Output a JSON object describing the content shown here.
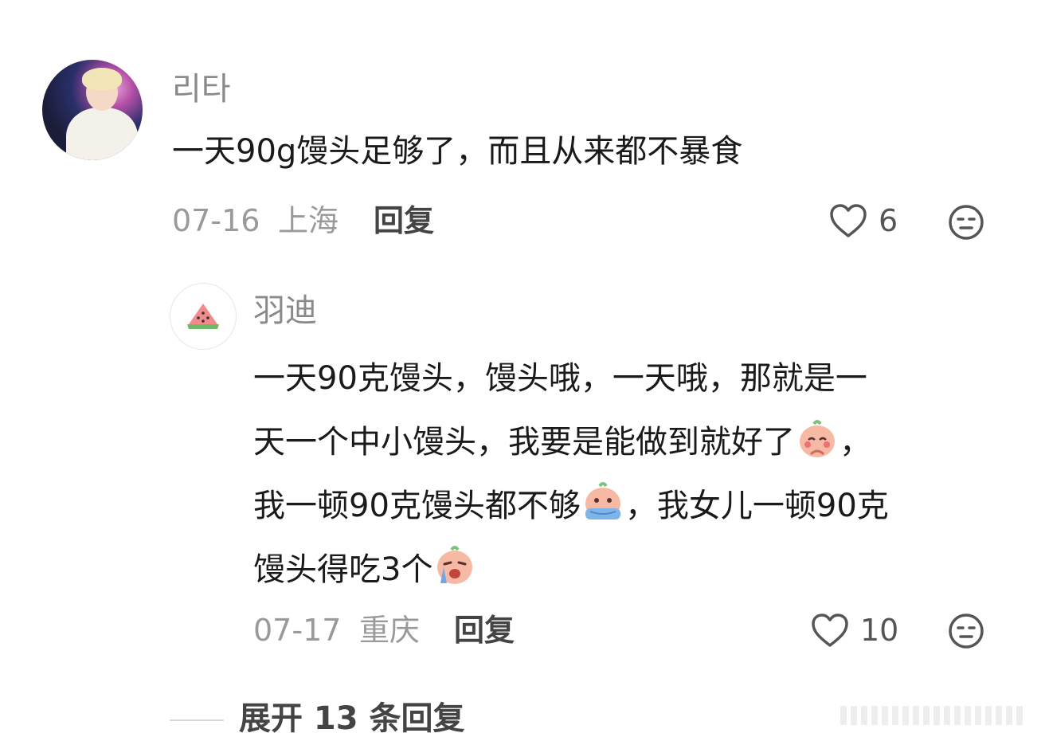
{
  "comment": {
    "username": "리타",
    "text": "一天90g馒头足够了，而且从来都不暴食",
    "date": "07-16",
    "location": "上海",
    "reply_label": "回复",
    "likes": "6",
    "icons": {
      "avatar": "user-avatar",
      "like": "heart-outline-icon",
      "more": "neutral-face-icon"
    }
  },
  "reply": {
    "username": "羽迪",
    "line1": "一天90克馒头，馒头哦，一天哦，那就是一",
    "line2a": "天一个中小馒头，我要是能做到就好了",
    "line2b": "，",
    "line3a": "我一顿90克馒头都不够",
    "line3b": "，我女儿一顿90克",
    "line4a": "馒头得吃3个",
    "date": "07-17",
    "location": "重庆",
    "reply_label": "回复",
    "likes": "10",
    "icons": {
      "avatar": "watermelon-avatar",
      "emoji1": "shy-emoji",
      "emoji2": "crying-emoji",
      "emoji3": "sobbing-emoji",
      "like": "heart-outline-icon",
      "more": "neutral-face-icon"
    }
  },
  "expand": {
    "label": "展开 13 条回复"
  }
}
